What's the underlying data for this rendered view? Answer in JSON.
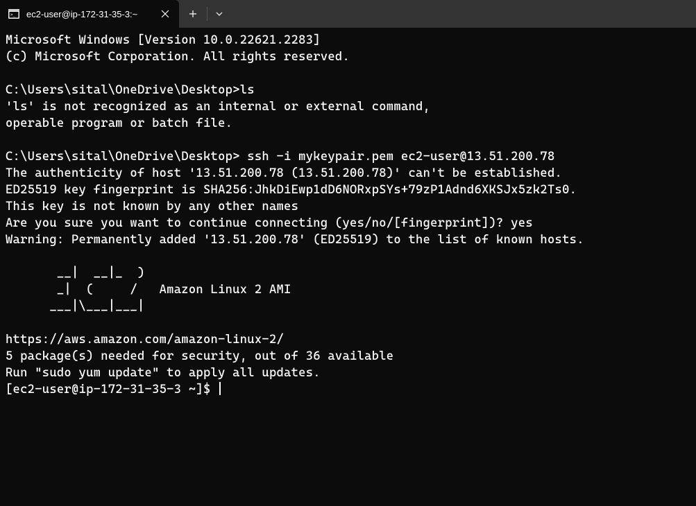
{
  "tab": {
    "title": "ec2-user@ip-172-31-35-3:~"
  },
  "terminal": {
    "lines": [
      "Microsoft Windows [Version 10.0.22621.2283]",
      "(c) Microsoft Corporation. All rights reserved.",
      "",
      "C:\\Users\\sital\\OneDrive\\Desktop>ls",
      "'ls' is not recognized as an internal or external command,",
      "operable program or batch file.",
      "",
      "C:\\Users\\sital\\OneDrive\\Desktop> ssh -i mykeypair.pem ec2-user@13.51.200.78",
      "The authenticity of host '13.51.200.78 (13.51.200.78)' can't be established.",
      "ED25519 key fingerprint is SHA256:JhkDiEwp1dD6NORxpSYs+79zP1Adnd6XKSJx5zk2Ts0.",
      "This key is not known by any other names",
      "Are you sure you want to continue connecting (yes/no/[fingerprint])? yes",
      "Warning: Permanently added '13.51.200.78' (ED25519) to the list of known hosts.",
      "",
      "       __|  __|_  )",
      "       _|  (     /   Amazon Linux 2 AMI",
      "      ___|\\___|___|",
      "",
      "https://aws.amazon.com/amazon-linux-2/",
      "5 package(s) needed for security, out of 36 available",
      "Run \"sudo yum update\" to apply all updates."
    ],
    "prompt": "[ec2-user@ip-172-31-35-3 ~]$ "
  }
}
